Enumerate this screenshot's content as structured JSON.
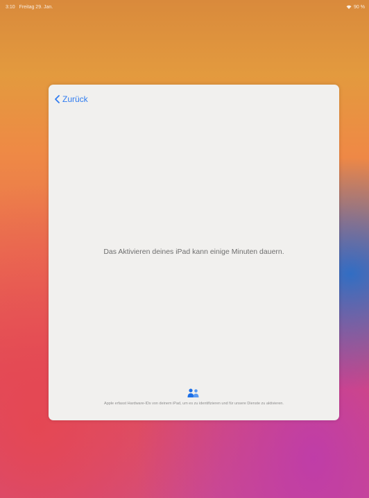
{
  "status_bar": {
    "time": "3:10",
    "date": "Freitag 29. Jan.",
    "battery": "90 %"
  },
  "sheet": {
    "back_label": "Zurück",
    "message": "Das Aktivieren deines iPad kann einige Minuten dauern.",
    "footer": "Apple erfasst Hardware-IDs von deinem iPad, um es zu identifizieren und für unsere Dienste zu aktivieren."
  },
  "colors": {
    "accent": "#2f7bf0",
    "sheet_background": "#f1f0ee"
  },
  "icons": {
    "back": "chevron-left-icon",
    "privacy": "people-icon",
    "wifi": "wifi-icon"
  }
}
